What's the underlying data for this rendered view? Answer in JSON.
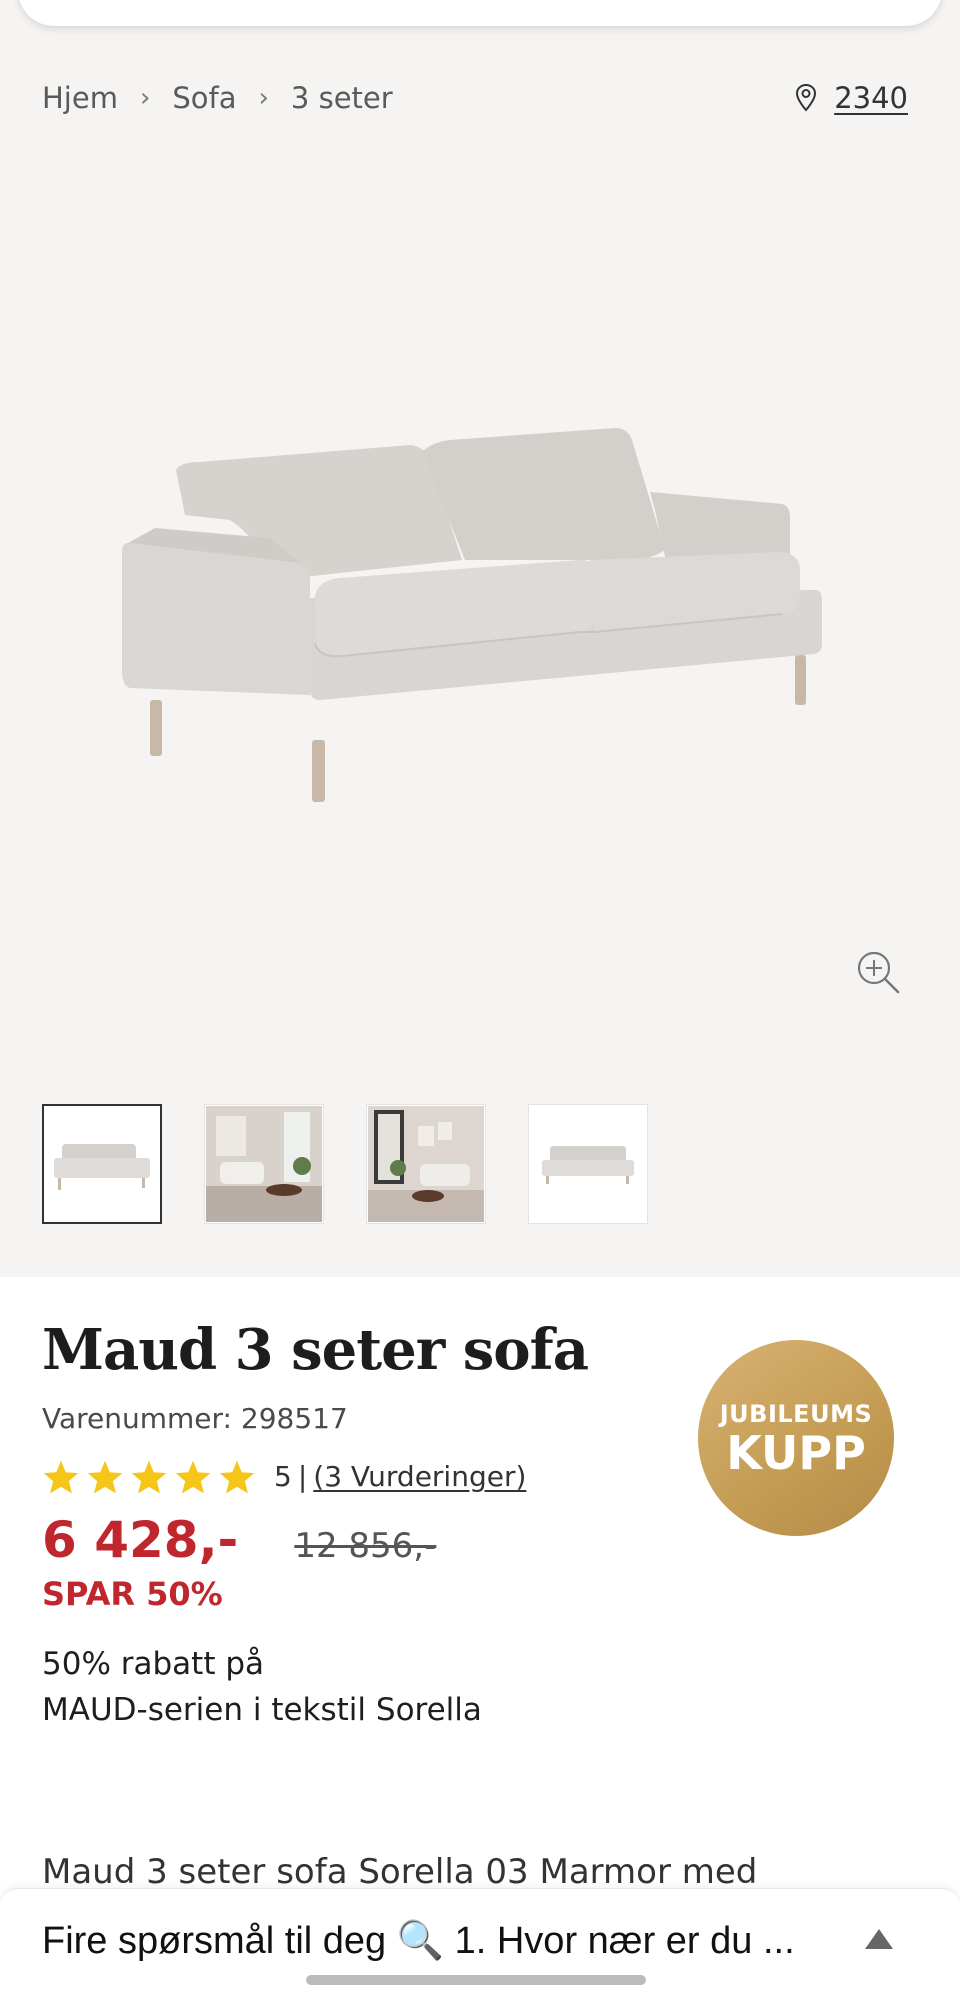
{
  "breadcrumb": {
    "items": [
      "Hjem",
      "Sofa",
      "3 seter"
    ],
    "separator": "›"
  },
  "location": {
    "code": "2340",
    "icon": "location-pin-icon"
  },
  "gallery": {
    "zoom_icon": "zoom-in-icon",
    "thumbnails": [
      "sofa-front",
      "living-room-1",
      "living-room-2",
      "sofa-straight"
    ]
  },
  "product": {
    "title": "Maud 3 seter sofa",
    "sku": "Varenummer: 298517",
    "rating": {
      "value": "5",
      "max_stars": 5,
      "separator": "|",
      "reviews_label": "(3 Vurderinger)"
    },
    "price": "6 428,-",
    "old_price": "12 856,-",
    "save": "SPAR 50%",
    "promo_line1": "50% rabatt på",
    "promo_line2": "MAUD-serien i tekstil Sorella",
    "description_peek": "Maud 3 seter sofa Sorella 03 Marmor med"
  },
  "badge": {
    "top": "JUBILEUMS",
    "bottom": "KUPP"
  },
  "bottom_bar": {
    "text": "Fire spørsmål til deg 🔍 1. Hvor nær er du ..."
  },
  "colors": {
    "accent_red": "#c0262d",
    "badge_gold": "#c9a05a",
    "star_yellow": "#f5c518",
    "gallery_bg": "#f5f4f2"
  }
}
